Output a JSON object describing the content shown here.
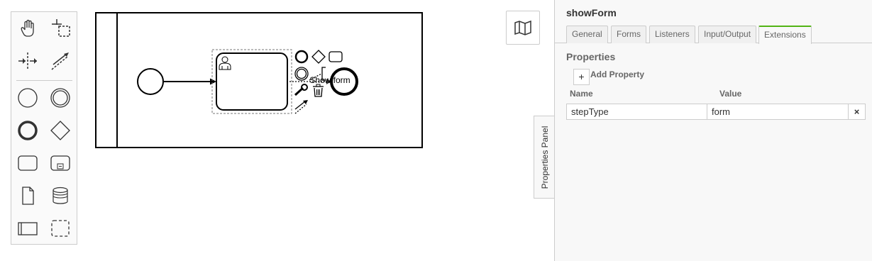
{
  "palette": {
    "tools": [
      {
        "name": "hand-tool-icon"
      },
      {
        "name": "lasso-tool-icon"
      },
      {
        "name": "space-tool-icon"
      },
      {
        "name": "global-connect-tool-icon"
      },
      {
        "name": "create-start-event-icon"
      },
      {
        "name": "create-intermediate-event-icon"
      },
      {
        "name": "create-end-event-icon"
      },
      {
        "name": "create-gateway-icon"
      },
      {
        "name": "create-task-icon"
      },
      {
        "name": "create-subprocess-icon"
      },
      {
        "name": "create-data-object-icon"
      },
      {
        "name": "create-data-store-icon"
      },
      {
        "name": "create-pool-icon"
      },
      {
        "name": "create-group-icon"
      }
    ]
  },
  "diagram": {
    "task_label": "Show form",
    "selection_color": "#999999"
  },
  "minimap": {
    "icon": "map-icon"
  },
  "properties_toggle": {
    "label": "Properties Panel"
  },
  "panel": {
    "title": "showForm",
    "tabs": [
      "General",
      "Forms",
      "Listeners",
      "Input/Output",
      "Extensions"
    ],
    "active_tab": "Extensions",
    "accent_color": "#52b415",
    "group_title": "Properties",
    "add_button": "+",
    "add_label": "Add Property",
    "columns": {
      "name": "Name",
      "value": "Value"
    },
    "rows": [
      {
        "name": "stepType",
        "value": "form",
        "delete": "×"
      }
    ]
  }
}
